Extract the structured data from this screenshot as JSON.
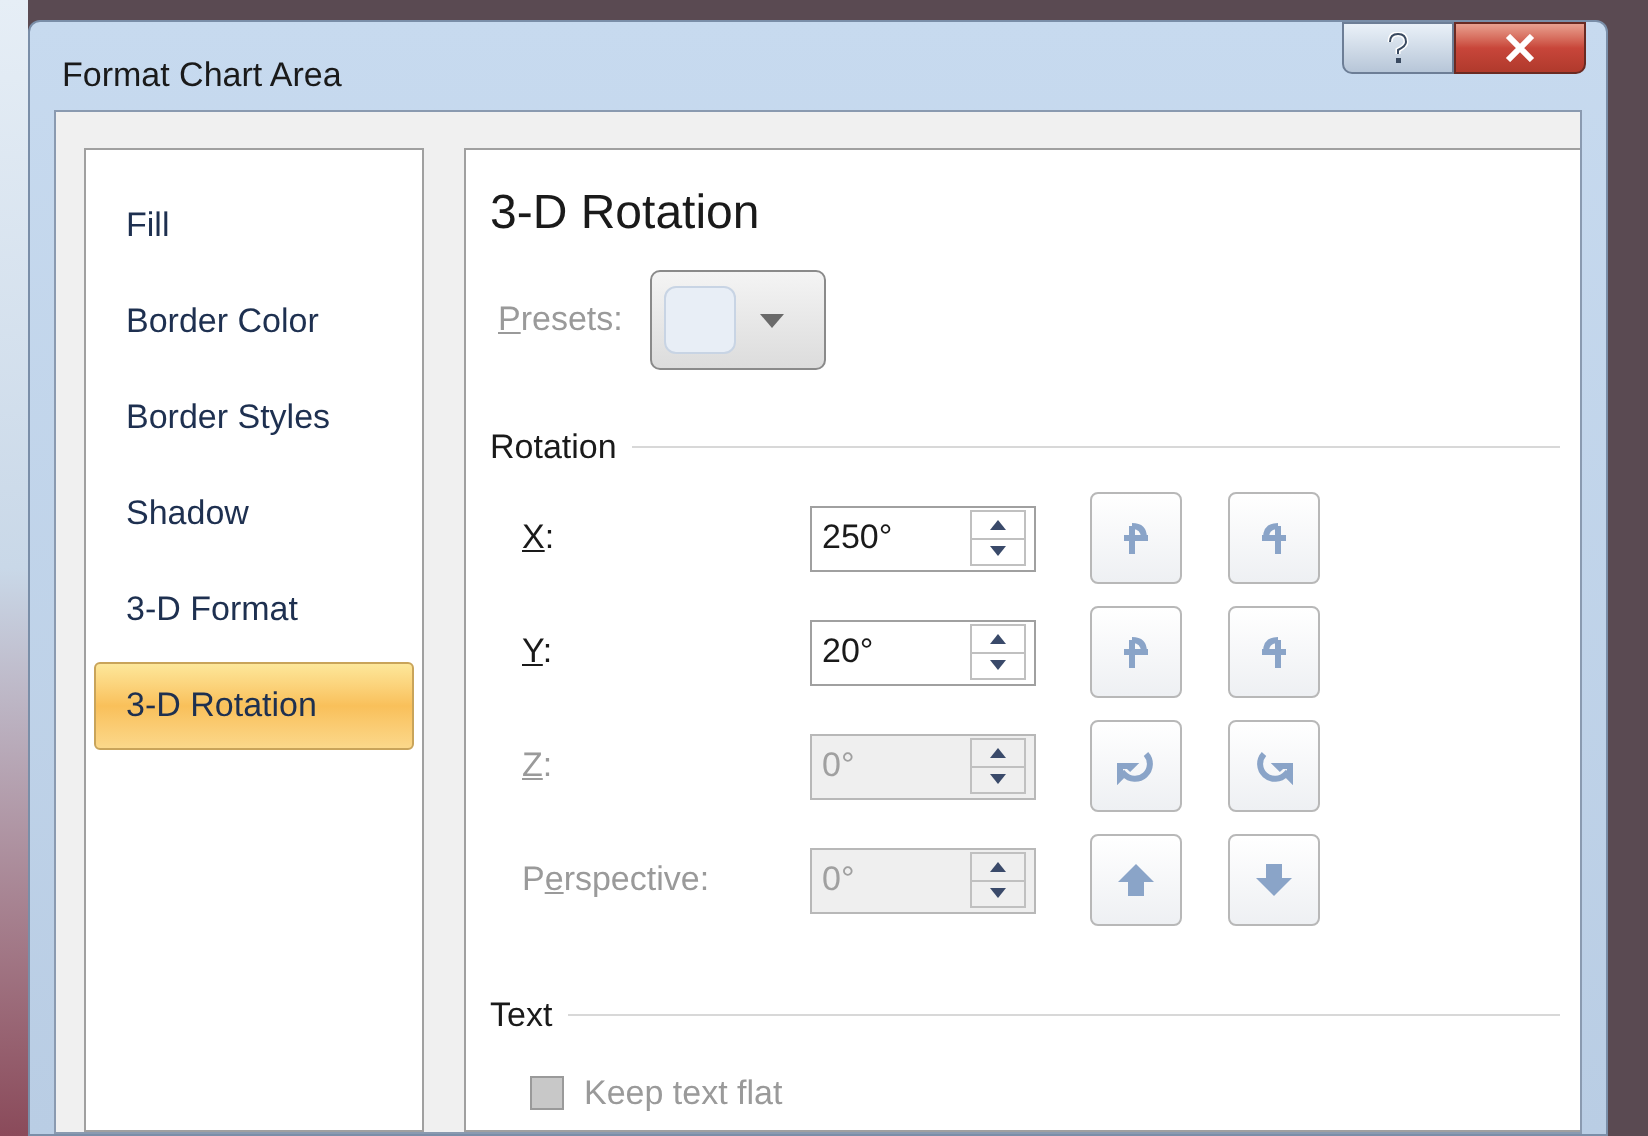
{
  "window": {
    "title": "Format Chart Area"
  },
  "sidebar": {
    "items": [
      {
        "label": "Fill",
        "selected": false
      },
      {
        "label": "Border Color",
        "selected": false
      },
      {
        "label": "Border Styles",
        "selected": false
      },
      {
        "label": "Shadow",
        "selected": false
      },
      {
        "label": "3-D Format",
        "selected": false
      },
      {
        "label": "3-D Rotation",
        "selected": true
      }
    ]
  },
  "panel": {
    "title": "3-D Rotation",
    "presets": {
      "label": {
        "key": "P",
        "post": "resets:"
      },
      "disabled": true
    },
    "rotation": {
      "heading": "Rotation",
      "rows": [
        {
          "label": {
            "key": "X",
            "post": ":"
          },
          "value": "250°",
          "disabled": false
        },
        {
          "label": {
            "key": "Y",
            "post": ":"
          },
          "value": "20°",
          "disabled": false
        },
        {
          "label": {
            "key": "Z",
            "post": ":"
          },
          "value": "0°",
          "disabled": true
        },
        {
          "label": {
            "pre": "P",
            "key": "e",
            "post": "rspective:"
          },
          "value": "0°",
          "disabled": true
        }
      ]
    },
    "text": {
      "heading": "Text",
      "keep_flat": {
        "label": "Keep text flat",
        "checked": false,
        "disabled": true
      }
    }
  }
}
